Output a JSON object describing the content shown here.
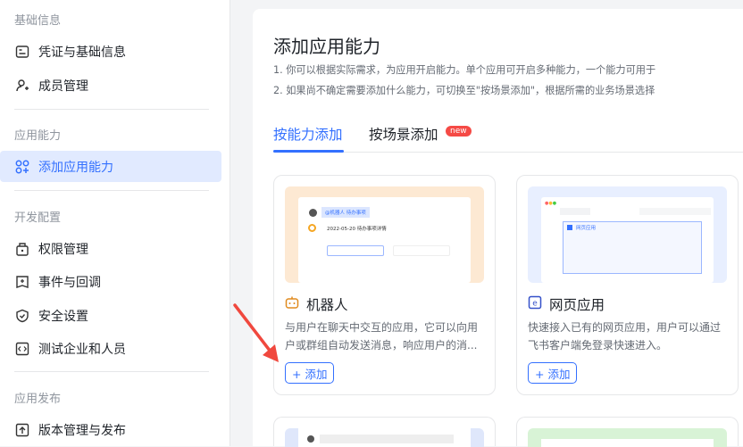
{
  "sidebar": {
    "sections": [
      "基础信息",
      "应用能力",
      "开发配置",
      "应用发布"
    ],
    "items": [
      {
        "label": "凭证与基础信息",
        "icon": "credential-icon"
      },
      {
        "label": "成员管理",
        "icon": "member-add-icon"
      },
      {
        "label": "添加应用能力",
        "icon": "add-capability-icon",
        "active": true
      },
      {
        "label": "权限管理",
        "icon": "lock-icon"
      },
      {
        "label": "事件与回调",
        "icon": "event-icon"
      },
      {
        "label": "安全设置",
        "icon": "shield-icon"
      },
      {
        "label": "测试企业和人员",
        "icon": "code-icon"
      },
      {
        "label": "版本管理与发布",
        "icon": "upload-icon"
      }
    ]
  },
  "main": {
    "title": "添加应用能力",
    "desc1": "1. 你可以根据实际需求，为应用开启能力。单个应用可开启多种能力，一个能力可用于",
    "desc2": "2. 如果尚不确定需要添加什么能力，可切换至\"按场景添加\"，根据所需的业务场景选择",
    "tabs": [
      {
        "label": "按能力添加",
        "active": true
      },
      {
        "label": "按场景添加",
        "badge": "new"
      }
    ],
    "cards": [
      {
        "title": "机器人",
        "desc": "与用户在聊天中交互的应用，它可以向用户或群组自动发送消息，响应用户的消...",
        "add": "+ 添加",
        "preview_tag": "@机器人 待办事项",
        "preview_text": "2022-05-20 待办事项详情"
      },
      {
        "title": "网页应用",
        "desc": "快速接入已有的网页应用，用户可以通过飞书客户端免登录快速进入。",
        "add": "+ 添加",
        "preview_text": "网页应用"
      }
    ]
  },
  "colors": {
    "accent": "#3370ff",
    "badge": "#f54a45",
    "robot_bg": "#fde9d3",
    "web_bg": "#e8efff",
    "arrow": "#f0483e"
  }
}
